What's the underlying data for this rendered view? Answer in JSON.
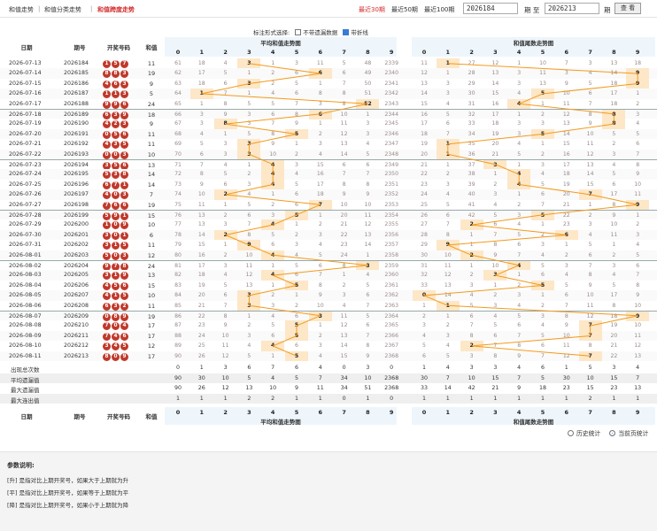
{
  "nav": {
    "items": [
      "和值走势",
      "和值分类走势",
      "和值跨度走势"
    ],
    "active_index": 2,
    "quick": [
      "最近30期",
      "最近50期",
      "最近100期"
    ],
    "from_value": "2026184",
    "sep_label": "期 至",
    "to_value": "2026213",
    "to_suffix": "期",
    "query_label": "查 看"
  },
  "options": {
    "label": "标注形式选择:",
    "opt1": "不带遗漏数据",
    "opt1_checked": false,
    "opt2": "带折线",
    "opt2_checked": true
  },
  "headers": {
    "date": "日期",
    "issue": "期号",
    "balls": "开奖号码",
    "sum": "和值",
    "sect1": "平均和值走势图",
    "sect2": "和值尾数走势图",
    "digits": [
      "0",
      "1",
      "2",
      "3",
      "4",
      "5",
      "6",
      "7",
      "8",
      "9"
    ]
  },
  "rows": [
    {
      "date": "2026-07-13",
      "issue": "2026184",
      "balls": [
        "1",
        "5",
        "7"
      ],
      "sum": "11",
      "s1": [
        "61",
        "18",
        "4",
        "3",
        "1",
        "3",
        "11",
        "5",
        "48",
        "2339"
      ],
      "h1": 3,
      "s2": [
        "11",
        "1",
        "27",
        "12",
        "1",
        "10",
        "7",
        "3",
        "13",
        "18"
      ],
      "h2": 1
    },
    {
      "date": "2026-07-14",
      "issue": "2026185",
      "balls": [
        "8",
        "8",
        "3"
      ],
      "sum": "19",
      "s1": [
        "62",
        "17",
        "5",
        "1",
        "2",
        "6",
        "6",
        "6",
        "49",
        "2340"
      ],
      "h1": 6,
      "s2": [
        "12",
        "1",
        "28",
        "13",
        "3",
        "11",
        "3",
        "4",
        "14",
        "9"
      ],
      "h2": 9
    },
    {
      "date": "2026-07-15",
      "issue": "2026186",
      "balls": [
        "4",
        "6",
        "3"
      ],
      "sum": "9",
      "s1": [
        "63",
        "18",
        "6",
        "3",
        "2",
        "5",
        "1",
        "7",
        "50",
        "2341"
      ],
      "h1": 3,
      "s2": [
        "13",
        "3",
        "29",
        "14",
        "3",
        "13",
        "9",
        "5",
        "18",
        "9"
      ],
      "h2": 9
    },
    {
      "date": "2026-07-16",
      "issue": "2026187",
      "balls": [
        "1",
        "1",
        "3"
      ],
      "sum": "5",
      "s1": [
        "64",
        "1",
        "7",
        "1",
        "4",
        "6",
        "8",
        "8",
        "51",
        "2342"
      ],
      "h1": 1,
      "s2": [
        "14",
        "3",
        "30",
        "15",
        "4",
        "5",
        "10",
        "6",
        "17",
        "1"
      ],
      "h2": 5
    },
    {
      "date": "2026-07-17",
      "issue": "2026188",
      "balls": [
        "9",
        "9",
        "6"
      ],
      "sum": "24",
      "s1": [
        "65",
        "1",
        "8",
        "5",
        "5",
        "7",
        "3",
        "8",
        "52",
        "2343"
      ],
      "h1": 8,
      "s2": [
        "15",
        "4",
        "31",
        "16",
        "4",
        "1",
        "11",
        "7",
        "18",
        "2"
      ],
      "h2": 4
    },
    {
      "date": "2026-07-18",
      "issue": "2026189",
      "balls": [
        "6",
        "3",
        "9"
      ],
      "sum": "18",
      "s1": [
        "66",
        "3",
        "9",
        "3",
        "6",
        "8",
        "6",
        "10",
        "1",
        "2344"
      ],
      "h1": 6,
      "s2": [
        "16",
        "5",
        "32",
        "17",
        "1",
        "2",
        "12",
        "8",
        "8",
        "3"
      ],
      "h2": 8
    },
    {
      "date": "2026-07-19",
      "issue": "2026190",
      "balls": [
        "4",
        "2",
        "3"
      ],
      "sum": "9",
      "s1": [
        "67",
        "3",
        "8",
        "3",
        "7",
        "9",
        "1",
        "11",
        "3",
        "2345"
      ],
      "h1": 2,
      "s2": [
        "17",
        "6",
        "33",
        "18",
        "3",
        "3",
        "13",
        "9",
        "8",
        "4"
      ],
      "h2": 8
    },
    {
      "date": "2026-07-20",
      "issue": "2026191",
      "balls": [
        "0",
        "5",
        "6"
      ],
      "sum": "11",
      "s1": [
        "68",
        "4",
        "1",
        "5",
        "8",
        "5",
        "2",
        "12",
        "3",
        "2346"
      ],
      "h1": 5,
      "s2": [
        "18",
        "7",
        "34",
        "19",
        "3",
        "5",
        "14",
        "10",
        "5",
        "5"
      ],
      "h2": 5
    },
    {
      "date": "2026-07-21",
      "issue": "2026192",
      "balls": [
        "4",
        "3",
        "5"
      ],
      "sum": "11",
      "s1": [
        "69",
        "5",
        "3",
        "3",
        "9",
        "1",
        "3",
        "13",
        "4",
        "2347"
      ],
      "h1": 3,
      "s2": [
        "19",
        "1",
        "35",
        "20",
        "4",
        "1",
        "15",
        "11",
        "2",
        "6"
      ],
      "h2": 1
    },
    {
      "date": "2026-07-22",
      "issue": "2026193",
      "balls": [
        "0",
        "0",
        "3"
      ],
      "sum": "10",
      "s1": [
        "70",
        "6",
        "3",
        "3",
        "10",
        "2",
        "4",
        "14",
        "5",
        "2348"
      ],
      "h1": 3,
      "s2": [
        "20",
        "1",
        "36",
        "21",
        "5",
        "2",
        "16",
        "12",
        "3",
        "7"
      ],
      "h2": 1
    },
    {
      "date": "2026-07-23",
      "issue": "2026194",
      "balls": [
        "3",
        "5",
        "6"
      ],
      "sum": "13",
      "s1": [
        "71",
        "7",
        "4",
        "1",
        "4",
        "3",
        "15",
        "6",
        "6",
        "2349"
      ],
      "h1": 4,
      "s2": [
        "21",
        "1",
        "37",
        "3",
        "1",
        "3",
        "17",
        "13",
        "4",
        "8"
      ],
      "h2": 3
    },
    {
      "date": "2026-07-24",
      "issue": "2026195",
      "balls": [
        "5",
        "3",
        "8"
      ],
      "sum": "14",
      "s1": [
        "72",
        "8",
        "5",
        "2",
        "4",
        "4",
        "16",
        "7",
        "7",
        "2350"
      ],
      "h1": 4,
      "s2": [
        "22",
        "2",
        "38",
        "1",
        "4",
        "4",
        "18",
        "14",
        "5",
        "9"
      ],
      "h2": 4
    },
    {
      "date": "2026-07-25",
      "issue": "2026196",
      "balls": [
        "6",
        "7",
        "1"
      ],
      "sum": "14",
      "s1": [
        "73",
        "9",
        "6",
        "3",
        "4",
        "5",
        "17",
        "8",
        "8",
        "2351"
      ],
      "h1": 4,
      "s2": [
        "23",
        "3",
        "39",
        "2",
        "4",
        "5",
        "19",
        "15",
        "6",
        "10"
      ],
      "h2": 4
    },
    {
      "date": "2026-07-26",
      "issue": "2026197",
      "balls": [
        "4",
        "0",
        "3"
      ],
      "sum": "7",
      "s1": [
        "74",
        "10",
        "2",
        "4",
        "1",
        "6",
        "18",
        "9",
        "9",
        "2352"
      ],
      "h1": 2,
      "s2": [
        "24",
        "4",
        "40",
        "3",
        "1",
        "6",
        "20",
        "7",
        "17",
        "11"
      ],
      "h2": 7
    },
    {
      "date": "2026-07-27",
      "issue": "2026198",
      "balls": [
        "7",
        "6",
        "6"
      ],
      "sum": "19",
      "s1": [
        "75",
        "11",
        "1",
        "5",
        "2",
        "6",
        "7",
        "10",
        "10",
        "2353"
      ],
      "h1": 6,
      "s2": [
        "25",
        "5",
        "41",
        "4",
        "2",
        "7",
        "21",
        "1",
        "8",
        "9"
      ],
      "h2": 9
    },
    {
      "date": "2026-07-28",
      "issue": "2026199",
      "balls": [
        "5",
        "9",
        "1"
      ],
      "sum": "15",
      "s1": [
        "76",
        "13",
        "2",
        "6",
        "3",
        "5",
        "1",
        "20",
        "11",
        "2354"
      ],
      "h1": 5,
      "s2": [
        "26",
        "6",
        "42",
        "5",
        "3",
        "5",
        "22",
        "2",
        "9",
        "1"
      ],
      "h2": 5
    },
    {
      "date": "2026-07-29",
      "issue": "2026200",
      "balls": [
        "1",
        "0",
        "9"
      ],
      "sum": "10",
      "s1": [
        "77",
        "13",
        "3",
        "7",
        "4",
        "1",
        "2",
        "21",
        "12",
        "2355"
      ],
      "h1": 4,
      "s2": [
        "27",
        "7",
        "2",
        "6",
        "4",
        "1",
        "23",
        "3",
        "10",
        "2"
      ],
      "h2": 2
    },
    {
      "date": "2026-07-30",
      "issue": "2026201",
      "balls": [
        "3",
        "0",
        "1"
      ],
      "sum": "6",
      "s1": [
        "78",
        "14",
        "2",
        "8",
        "5",
        "2",
        "3",
        "22",
        "13",
        "2356"
      ],
      "h1": 2,
      "s2": [
        "28",
        "8",
        "1",
        "7",
        "5",
        "2",
        "6",
        "4",
        "11",
        "3"
      ],
      "h2": 6
    },
    {
      "date": "2026-07-31",
      "issue": "2026202",
      "balls": [
        "3",
        "1",
        "5"
      ],
      "sum": "11",
      "s1": [
        "79",
        "15",
        "1",
        "9",
        "6",
        "3",
        "4",
        "23",
        "14",
        "2357"
      ],
      "h1": 3,
      "s2": [
        "29",
        "9",
        "1",
        "8",
        "6",
        "3",
        "1",
        "5",
        "1",
        "4"
      ],
      "h2": 1
    },
    {
      "date": "2026-08-01",
      "issue": "2026203",
      "balls": [
        "5",
        "0",
        "3"
      ],
      "sum": "12",
      "s1": [
        "80",
        "16",
        "2",
        "10",
        "4",
        "4",
        "5",
        "24",
        "1",
        "2358"
      ],
      "h1": 4,
      "s2": [
        "30",
        "10",
        "2",
        "9",
        "7",
        "4",
        "2",
        "6",
        "2",
        "5"
      ],
      "h2": 2
    },
    {
      "date": "2026-08-02",
      "issue": "2026204",
      "balls": [
        "9",
        "7",
        "8"
      ],
      "sum": "24",
      "s1": [
        "81",
        "17",
        "3",
        "11",
        "1",
        "5",
        "6",
        "8",
        "3",
        "2359"
      ],
      "h1": 8,
      "s2": [
        "31",
        "11",
        "1",
        "10",
        "4",
        "5",
        "3",
        "7",
        "3",
        "6"
      ],
      "h2": 4
    },
    {
      "date": "2026-08-03",
      "issue": "2026205",
      "balls": [
        "3",
        "1",
        "9"
      ],
      "sum": "13",
      "s1": [
        "82",
        "18",
        "4",
        "12",
        "4",
        "6",
        "7",
        "1",
        "4",
        "2360"
      ],
      "h1": 4,
      "s2": [
        "32",
        "12",
        "2",
        "3",
        "1",
        "6",
        "4",
        "8",
        "4",
        "7"
      ],
      "h2": 3
    },
    {
      "date": "2026-08-04",
      "issue": "2026206",
      "balls": [
        "4",
        "5",
        "6"
      ],
      "sum": "15",
      "s1": [
        "83",
        "19",
        "5",
        "13",
        "1",
        "5",
        "8",
        "2",
        "5",
        "2361"
      ],
      "h1": 5,
      "s2": [
        "33",
        "13",
        "3",
        "1",
        "2",
        "5",
        "5",
        "9",
        "5",
        "8"
      ],
      "h2": 5
    },
    {
      "date": "2026-08-05",
      "issue": "2026207",
      "balls": [
        "4",
        "1",
        "5"
      ],
      "sum": "10",
      "s1": [
        "84",
        "20",
        "6",
        "3",
        "2",
        "1",
        "9",
        "3",
        "6",
        "2362"
      ],
      "h1": 3,
      "s2": [
        "0",
        "14",
        "4",
        "2",
        "3",
        "1",
        "6",
        "10",
        "17",
        "9"
      ],
      "h2": 0
    },
    {
      "date": "2026-08-06",
      "issue": "2026208",
      "balls": [
        "6",
        "3",
        "2"
      ],
      "sum": "11",
      "s1": [
        "85",
        "21",
        "7",
        "3",
        "3",
        "2",
        "10",
        "4",
        "7",
        "2363"
      ],
      "h1": 3,
      "s2": [
        "1",
        "1",
        "5",
        "3",
        "4",
        "2",
        "7",
        "11",
        "8",
        "10"
      ],
      "h2": 1
    },
    {
      "date": "2026-08-07",
      "issue": "2026209",
      "balls": [
        "0",
        "8",
        "9"
      ],
      "sum": "19",
      "s1": [
        "86",
        "22",
        "8",
        "1",
        "4",
        "6",
        "3",
        "11",
        "5",
        "2364"
      ],
      "h1": 6,
      "s2": [
        "2",
        "1",
        "6",
        "4",
        "5",
        "3",
        "8",
        "12",
        "18",
        "9"
      ],
      "h2": 9
    },
    {
      "date": "2026-08-08",
      "issue": "2026210",
      "balls": [
        "7",
        "0",
        "4"
      ],
      "sum": "17",
      "s1": [
        "87",
        "23",
        "9",
        "2",
        "5",
        "5",
        "1",
        "12",
        "6",
        "2365"
      ],
      "h1": 5,
      "s2": [
        "3",
        "2",
        "7",
        "5",
        "6",
        "4",
        "9",
        "7",
        "19",
        "10"
      ],
      "h2": 7
    },
    {
      "date": "2026-08-09",
      "issue": "2026211",
      "balls": [
        "7",
        "4",
        "6"
      ],
      "sum": "17",
      "s1": [
        "88",
        "24",
        "10",
        "3",
        "6",
        "5",
        "2",
        "13",
        "7",
        "2366"
      ],
      "h1": 5,
      "s2": [
        "4",
        "3",
        "8",
        "6",
        "7",
        "5",
        "10",
        "7",
        "20",
        "11"
      ],
      "h2": 7
    },
    {
      "date": "2026-08-10",
      "issue": "2026212",
      "balls": [
        "3",
        "4",
        "5"
      ],
      "sum": "12",
      "s1": [
        "89",
        "25",
        "11",
        "4",
        "4",
        "6",
        "3",
        "14",
        "8",
        "2367"
      ],
      "h1": 4,
      "s2": [
        "5",
        "4",
        "2",
        "7",
        "8",
        "6",
        "11",
        "8",
        "21",
        "12"
      ],
      "h2": 2
    },
    {
      "date": "2026-08-11",
      "issue": "2026213",
      "balls": [
        "8",
        "0",
        "9"
      ],
      "sum": "17",
      "s1": [
        "90",
        "26",
        "12",
        "5",
        "1",
        "5",
        "4",
        "15",
        "9",
        "2368"
      ],
      "h1": 5,
      "s2": [
        "6",
        "5",
        "3",
        "8",
        "9",
        "7",
        "12",
        "7",
        "22",
        "13"
      ],
      "h2": 7
    }
  ],
  "stats": [
    {
      "label": "出现总次数",
      "s1": [
        "0",
        "1",
        "3",
        "6",
        "7",
        "6",
        "4",
        "0",
        "3",
        "0"
      ],
      "s2": [
        "1",
        "4",
        "3",
        "3",
        "4",
        "6",
        "1",
        "5",
        "3",
        "4"
      ]
    },
    {
      "label": "平均遗漏值",
      "s1": [
        "90",
        "30",
        "10",
        "5",
        "4",
        "5",
        "7",
        "34",
        "10",
        "2368"
      ],
      "s2": [
        "30",
        "7",
        "10",
        "15",
        "7",
        "5",
        "30",
        "10",
        "15",
        "7"
      ]
    },
    {
      "label": "最大遗漏值",
      "s1": [
        "90",
        "26",
        "12",
        "13",
        "10",
        "9",
        "11",
        "34",
        "51",
        "2368"
      ],
      "s2": [
        "33",
        "14",
        "42",
        "21",
        "9",
        "18",
        "23",
        "15",
        "23",
        "13"
      ]
    },
    {
      "label": "最大连出值",
      "s1": [
        "1",
        "1",
        "1",
        "2",
        "2",
        "1",
        "1",
        "0",
        "1",
        "0"
      ],
      "s2": [
        "1",
        "1",
        "1",
        "1",
        "1",
        "1",
        "1",
        "2",
        "1",
        "1"
      ]
    }
  ],
  "radio": {
    "opt1": "历史统计",
    "opt2": "当前页统计",
    "selected": 2
  },
  "notes": {
    "title": "参数说明:",
    "lines": [
      "[升] 是指对比上期开奖号，如果大于上期就为升",
      "[平] 是指对比上期开奖号，如果等于上期就为平",
      "[降] 是指对比上期开奖号，如果小于上期就为降"
    ]
  },
  "colors": {
    "active": "#d42b2b",
    "ball": "#c0392b",
    "line": "#f39a1c",
    "hit": "#fde7c7",
    "header": "#eef6fc"
  }
}
